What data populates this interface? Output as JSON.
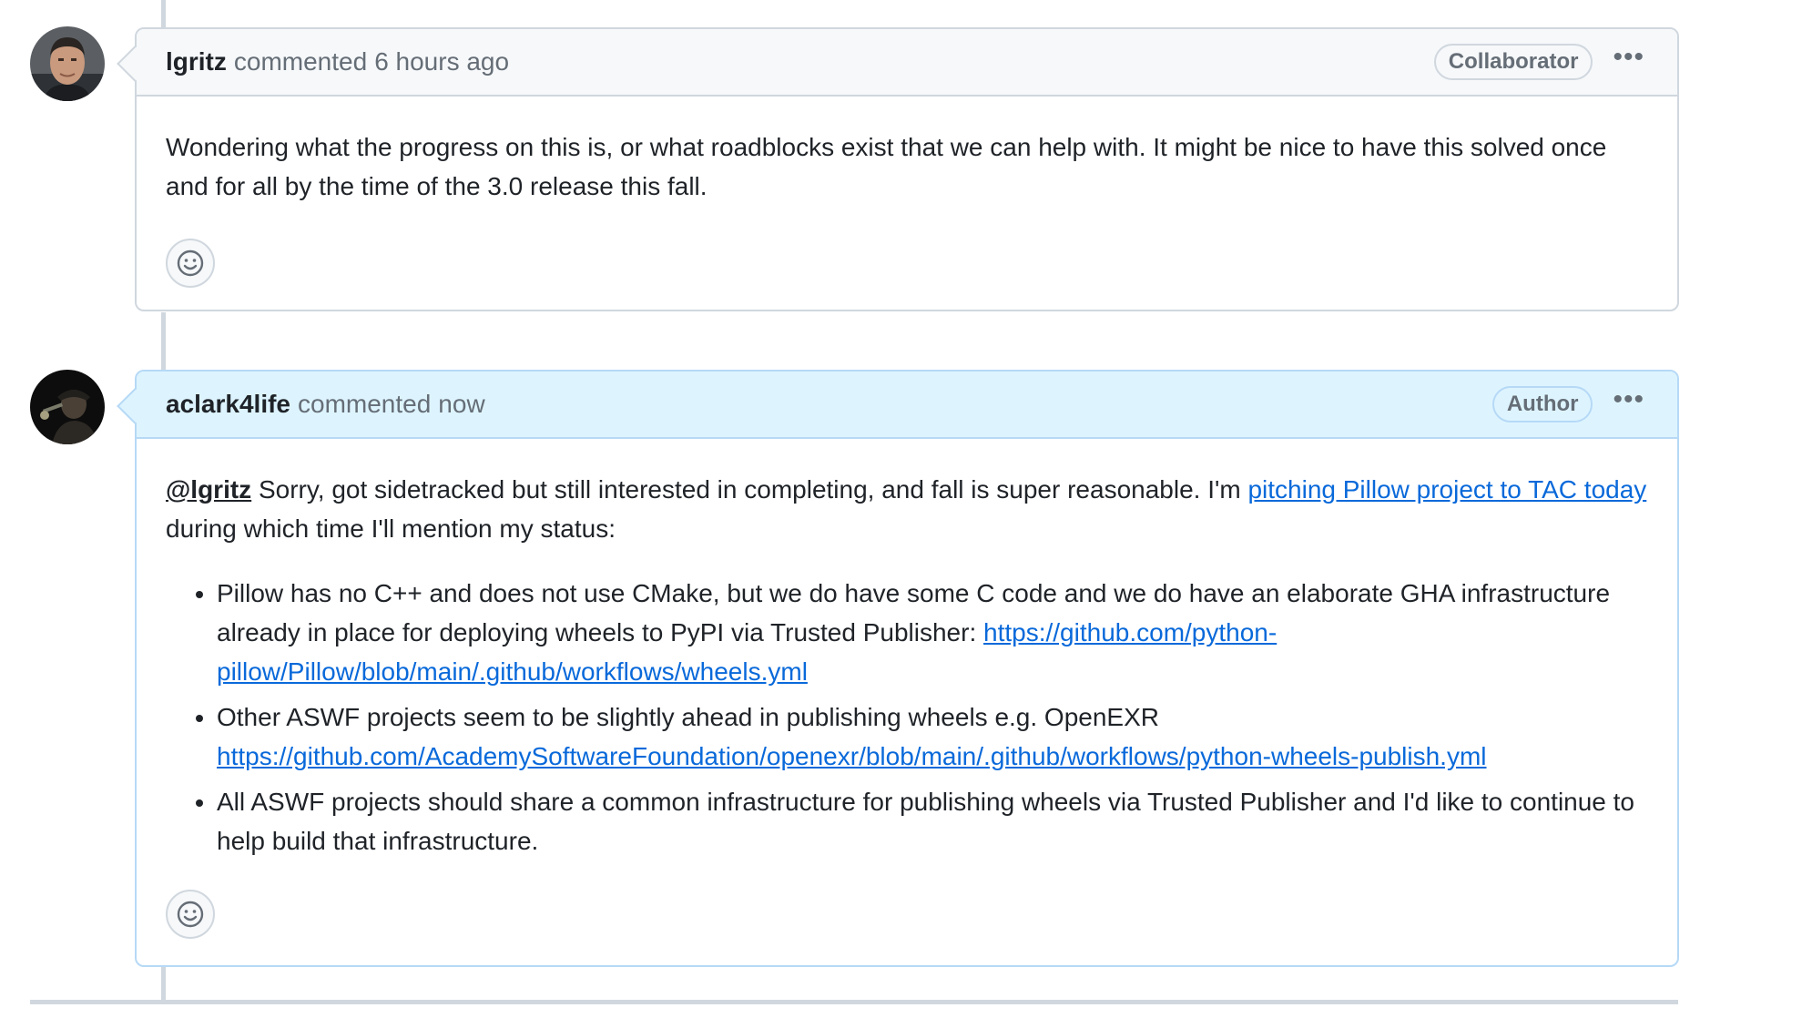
{
  "comments": [
    {
      "username": "lgritz",
      "action": "commented",
      "time": "6 hours ago",
      "role": "Collaborator",
      "avatar": "user-portrait-avatar",
      "body": "Wondering what the progress on this is, or what roadblocks exist that we can help with. It might be nice to have this solved once and for all by the time of the 3.0 release this fall."
    },
    {
      "username": "aclark4life",
      "action": "commented",
      "time": "now",
      "role": "Author",
      "avatar": "performer-silhouette-avatar",
      "mention": "@lgritz",
      "intro_text": " Sorry, got sidetracked but still interested in completing, and fall is super reasonable. I'm ",
      "intro_link": "pitching Pillow project to TAC today",
      "intro_tail": " during which time I'll mention my status:",
      "bullets": [
        {
          "text": "Pillow has no C++ and does not use CMake, but we do have some C code and we do have an elaborate GHA infrastructure already in place for deploying wheels to PyPI via Trusted Publisher: ",
          "link": "https://github.com/python-pillow/Pillow/blob/main/.github/workflows/wheels.yml"
        },
        {
          "text": "Other ASWF projects seem to be slightly ahead in publishing wheels e.g. OpenEXR ",
          "link": "https://github.com/AcademySoftwareFoundation/openexr/blob/main/.github/workflows/python-wheels-publish.yml"
        },
        {
          "text": "All ASWF projects should share a common infrastructure for publishing wheels via Trusted Publisher and I'd like to continue to help build that infrastructure.",
          "link": ""
        }
      ]
    }
  ],
  "icons": {
    "more": "kebab-horizontal-icon",
    "reaction": "smiley-icon"
  },
  "colors": {
    "link": "#0969da",
    "author_header": "#ddf4ff",
    "author_border": "#b6d9f6",
    "default_header": "#f6f8fa",
    "border": "#d0d7de"
  }
}
